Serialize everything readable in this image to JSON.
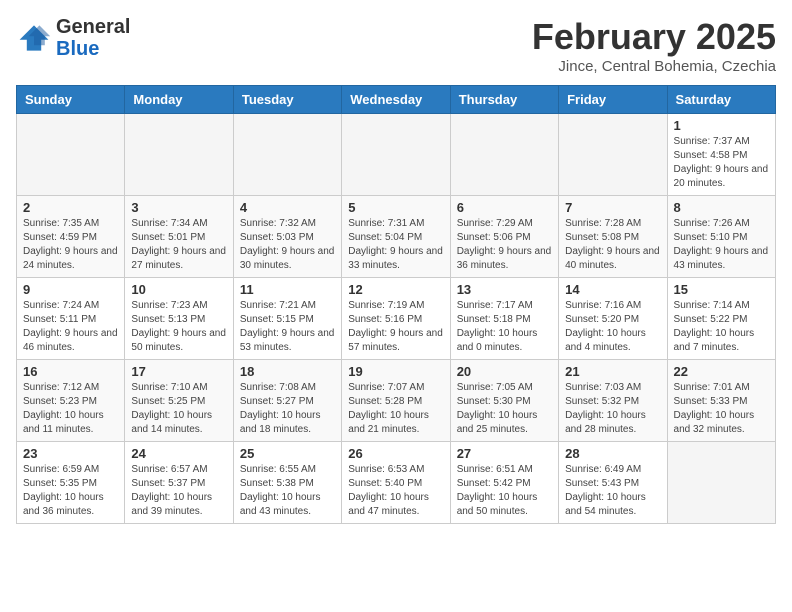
{
  "header": {
    "logo_general": "General",
    "logo_blue": "Blue",
    "title": "February 2025",
    "subtitle": "Jince, Central Bohemia, Czechia"
  },
  "days_of_week": [
    "Sunday",
    "Monday",
    "Tuesday",
    "Wednesday",
    "Thursday",
    "Friday",
    "Saturday"
  ],
  "weeks": [
    [
      {
        "day": "",
        "info": ""
      },
      {
        "day": "",
        "info": ""
      },
      {
        "day": "",
        "info": ""
      },
      {
        "day": "",
        "info": ""
      },
      {
        "day": "",
        "info": ""
      },
      {
        "day": "",
        "info": ""
      },
      {
        "day": "1",
        "info": "Sunrise: 7:37 AM\nSunset: 4:58 PM\nDaylight: 9 hours and 20 minutes."
      }
    ],
    [
      {
        "day": "2",
        "info": "Sunrise: 7:35 AM\nSunset: 4:59 PM\nDaylight: 9 hours and 24 minutes."
      },
      {
        "day": "3",
        "info": "Sunrise: 7:34 AM\nSunset: 5:01 PM\nDaylight: 9 hours and 27 minutes."
      },
      {
        "day": "4",
        "info": "Sunrise: 7:32 AM\nSunset: 5:03 PM\nDaylight: 9 hours and 30 minutes."
      },
      {
        "day": "5",
        "info": "Sunrise: 7:31 AM\nSunset: 5:04 PM\nDaylight: 9 hours and 33 minutes."
      },
      {
        "day": "6",
        "info": "Sunrise: 7:29 AM\nSunset: 5:06 PM\nDaylight: 9 hours and 36 minutes."
      },
      {
        "day": "7",
        "info": "Sunrise: 7:28 AM\nSunset: 5:08 PM\nDaylight: 9 hours and 40 minutes."
      },
      {
        "day": "8",
        "info": "Sunrise: 7:26 AM\nSunset: 5:10 PM\nDaylight: 9 hours and 43 minutes."
      }
    ],
    [
      {
        "day": "9",
        "info": "Sunrise: 7:24 AM\nSunset: 5:11 PM\nDaylight: 9 hours and 46 minutes."
      },
      {
        "day": "10",
        "info": "Sunrise: 7:23 AM\nSunset: 5:13 PM\nDaylight: 9 hours and 50 minutes."
      },
      {
        "day": "11",
        "info": "Sunrise: 7:21 AM\nSunset: 5:15 PM\nDaylight: 9 hours and 53 minutes."
      },
      {
        "day": "12",
        "info": "Sunrise: 7:19 AM\nSunset: 5:16 PM\nDaylight: 9 hours and 57 minutes."
      },
      {
        "day": "13",
        "info": "Sunrise: 7:17 AM\nSunset: 5:18 PM\nDaylight: 10 hours and 0 minutes."
      },
      {
        "day": "14",
        "info": "Sunrise: 7:16 AM\nSunset: 5:20 PM\nDaylight: 10 hours and 4 minutes."
      },
      {
        "day": "15",
        "info": "Sunrise: 7:14 AM\nSunset: 5:22 PM\nDaylight: 10 hours and 7 minutes."
      }
    ],
    [
      {
        "day": "16",
        "info": "Sunrise: 7:12 AM\nSunset: 5:23 PM\nDaylight: 10 hours and 11 minutes."
      },
      {
        "day": "17",
        "info": "Sunrise: 7:10 AM\nSunset: 5:25 PM\nDaylight: 10 hours and 14 minutes."
      },
      {
        "day": "18",
        "info": "Sunrise: 7:08 AM\nSunset: 5:27 PM\nDaylight: 10 hours and 18 minutes."
      },
      {
        "day": "19",
        "info": "Sunrise: 7:07 AM\nSunset: 5:28 PM\nDaylight: 10 hours and 21 minutes."
      },
      {
        "day": "20",
        "info": "Sunrise: 7:05 AM\nSunset: 5:30 PM\nDaylight: 10 hours and 25 minutes."
      },
      {
        "day": "21",
        "info": "Sunrise: 7:03 AM\nSunset: 5:32 PM\nDaylight: 10 hours and 28 minutes."
      },
      {
        "day": "22",
        "info": "Sunrise: 7:01 AM\nSunset: 5:33 PM\nDaylight: 10 hours and 32 minutes."
      }
    ],
    [
      {
        "day": "23",
        "info": "Sunrise: 6:59 AM\nSunset: 5:35 PM\nDaylight: 10 hours and 36 minutes."
      },
      {
        "day": "24",
        "info": "Sunrise: 6:57 AM\nSunset: 5:37 PM\nDaylight: 10 hours and 39 minutes."
      },
      {
        "day": "25",
        "info": "Sunrise: 6:55 AM\nSunset: 5:38 PM\nDaylight: 10 hours and 43 minutes."
      },
      {
        "day": "26",
        "info": "Sunrise: 6:53 AM\nSunset: 5:40 PM\nDaylight: 10 hours and 47 minutes."
      },
      {
        "day": "27",
        "info": "Sunrise: 6:51 AM\nSunset: 5:42 PM\nDaylight: 10 hours and 50 minutes."
      },
      {
        "day": "28",
        "info": "Sunrise: 6:49 AM\nSunset: 5:43 PM\nDaylight: 10 hours and 54 minutes."
      },
      {
        "day": "",
        "info": ""
      }
    ]
  ]
}
